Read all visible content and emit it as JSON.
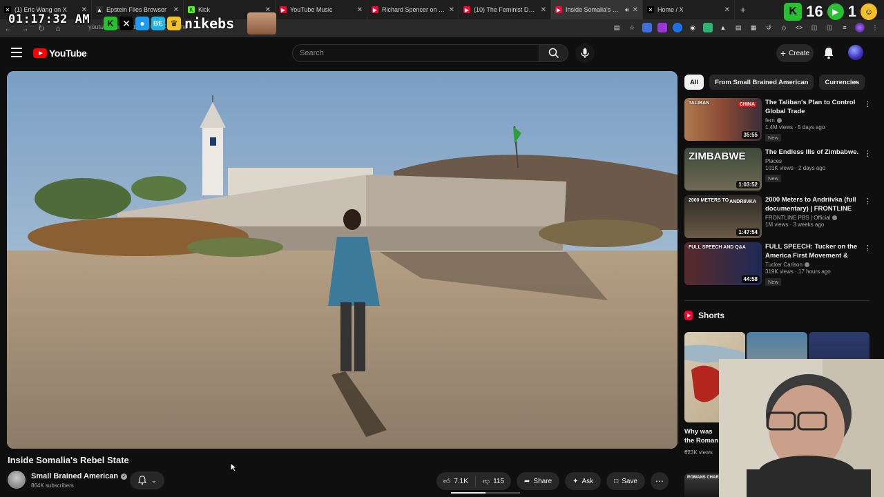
{
  "browser": {
    "tabs": [
      {
        "title": "(1) Eric Wang on X",
        "favicon": "x-icon",
        "color": "#000000",
        "active": false
      },
      {
        "title": "Epstein Files Browser",
        "favicon": "triangle-icon",
        "color": "#2f2f2f",
        "active": false
      },
      {
        "title": "Kick",
        "favicon": "kick-icon",
        "color": "#53fc18",
        "active": false
      },
      {
        "title": "YouTube Music",
        "favicon": "yt-music-icon",
        "color": "#ff0033",
        "active": false
      },
      {
        "title": "Richard Spencer on Isra",
        "favicon": "youtube-icon",
        "color": "#ff0033",
        "active": false
      },
      {
        "title": "(10) The Feminist Debat",
        "favicon": "youtube-icon",
        "color": "#ff0033",
        "active": false
      },
      {
        "title": "Inside Somalia's Rebel",
        "favicon": "youtube-icon",
        "color": "#ff0033",
        "active": true
      },
      {
        "title": "Home / X",
        "favicon": "x-icon",
        "color": "#000000",
        "active": false
      }
    ],
    "url": "youtube.com/watch?v=hTLF-s8Pjho",
    "new_tab_label": "+"
  },
  "stream_overlay": {
    "clock": "01:17:32 AM",
    "name": "nikebs",
    "counter_left": "16",
    "counter_right": "1"
  },
  "youtube": {
    "logo_text": "YouTube",
    "search_placeholder": "Search",
    "create_label": "Create",
    "accent": "#ff0000"
  },
  "video": {
    "title": "Inside Somalia's Rebel State",
    "channel": "Small Brained American",
    "subscribers": "864K subscribers",
    "likes": "7.1K",
    "dislikes": "115",
    "share_label": "Share",
    "ask_label": "Ask",
    "save_label": "Save"
  },
  "sidebar": {
    "chips": [
      "All",
      "From Small Brained American",
      "Currencies"
    ],
    "recommendations": [
      {
        "title": "The Taliban's Plan to Control Global Trade",
        "channel": "fern",
        "verified": true,
        "meta": "1.4M views · 5 days ago",
        "badge": "New",
        "duration": "35:55",
        "thumb_text": "TALIBAN",
        "thumb_text2": "CHINA"
      },
      {
        "title": "The Endless Ills of Zimbabwe.",
        "channel": "Places",
        "verified": false,
        "meta": "101K views · 2 days ago",
        "badge": "New",
        "duration": "1:03:52",
        "thumb_text": "ZIMBABWE",
        "thumb_text2": ""
      },
      {
        "title": "2000 Meters to Andriivka (full documentary) | FRONTLINE",
        "channel": "FRONTLINE PBS | Official",
        "verified": true,
        "meta": "1M views · 3 weeks ago",
        "badge": "",
        "duration": "1:47:54",
        "thumb_text": "2000 METERS TO",
        "thumb_text2": "ANDRIIVKA"
      },
      {
        "title": "FULL SPEECH: Tucker on the America First Movement & Ne...",
        "channel": "Tucker Carlson",
        "verified": true,
        "meta": "319K views · 17 hours ago",
        "badge": "New",
        "duration": "44:58",
        "thumb_text": "FULL SPEECH AND Q&A",
        "thumb_text2": ""
      }
    ],
    "shorts_label": "Shorts",
    "shorts": [
      {
        "caption": "Why was the Roman ...",
        "views": "623K views"
      }
    ],
    "short2_text": "ROMANS CHAR"
  }
}
